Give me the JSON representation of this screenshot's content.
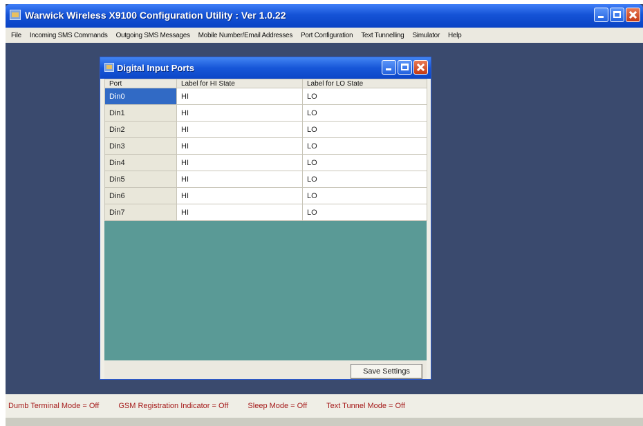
{
  "app": {
    "title": "Warwick Wireless X9100 Configuration Utility : Ver 1.0.22"
  },
  "menu": [
    "File",
    "Incoming SMS Commands",
    "Outgoing SMS Messages",
    "Mobile Number/Email Addresses",
    "Port Configuration",
    "Text Tunnelling",
    "Simulator",
    "Help"
  ],
  "dialog": {
    "title": "Digital Input Ports",
    "columns": [
      "Port",
      "Label for HI State",
      "Label for LO State"
    ],
    "rows": [
      {
        "port": "Din0",
        "hi": "HI",
        "lo": "LO"
      },
      {
        "port": "Din1",
        "hi": "HI",
        "lo": "LO"
      },
      {
        "port": "Din2",
        "hi": "HI",
        "lo": "LO"
      },
      {
        "port": "Din3",
        "hi": "HI",
        "lo": "LO"
      },
      {
        "port": "Din4",
        "hi": "HI",
        "lo": "LO"
      },
      {
        "port": "Din5",
        "hi": "HI",
        "lo": "LO"
      },
      {
        "port": "Din6",
        "hi": "HI",
        "lo": "LO"
      },
      {
        "port": "Din7",
        "hi": "HI",
        "lo": "LO"
      }
    ],
    "selected_row": 0,
    "save_label": "Save Settings"
  },
  "status": [
    "Dumb Terminal Mode = Off",
    "GSM Registration Indicator = Off",
    "Sleep Mode = Off",
    "Text Tunnel Mode = Off"
  ],
  "colors": {
    "desktop": "#3a4a6e",
    "title_bar": "#1553d6",
    "grid_background": "#5a9a96",
    "status_text": "#a51a1a",
    "selection": "#316ac5"
  },
  "icons": [
    "app-icon",
    "minimize-icon",
    "maximize-icon",
    "close-icon"
  ]
}
